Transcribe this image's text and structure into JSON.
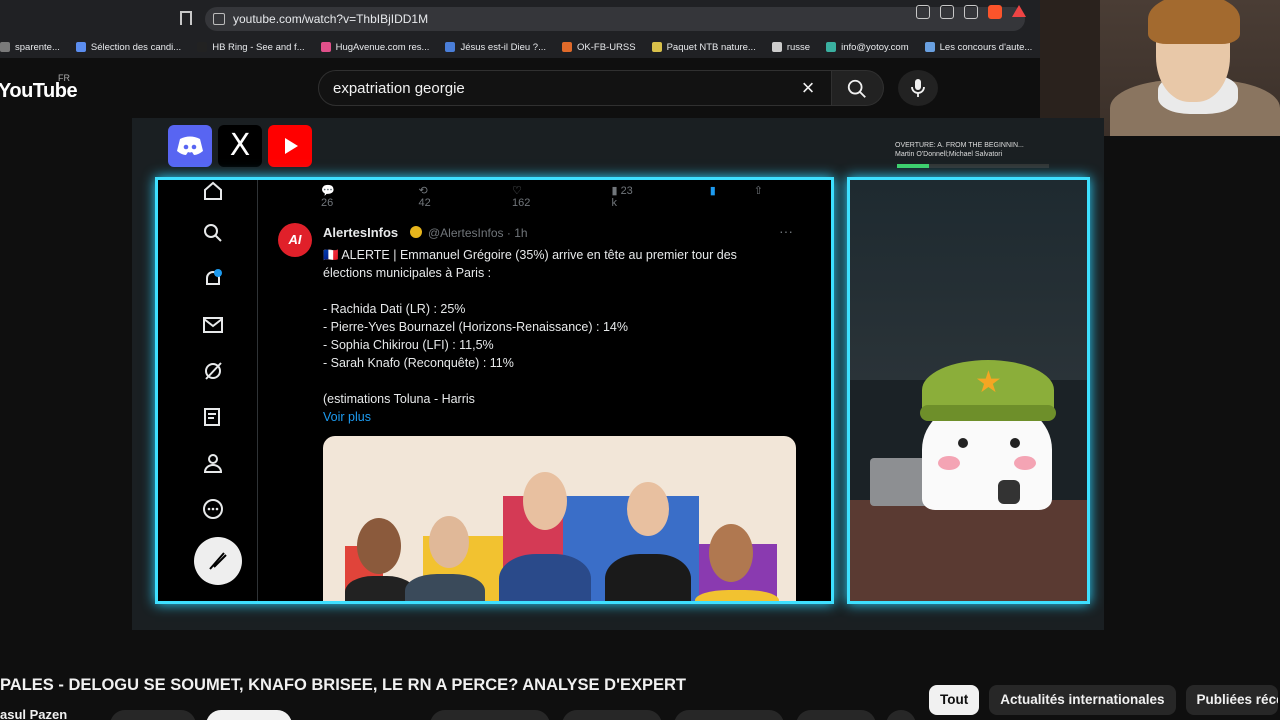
{
  "browser": {
    "url": "youtube.com/watch?v=ThbIBjIDD1M",
    "bookmarks": [
      {
        "label": "sparente...",
        "color": "#7a7a7a"
      },
      {
        "label": "Sélection des candi...",
        "color": "#5b8def"
      },
      {
        "label": "HB Ring - See and f...",
        "color": "#222222"
      },
      {
        "label": "HugAvenue.com res...",
        "color": "#e0508a"
      },
      {
        "label": "Jésus est-il Dieu ?...",
        "color": "#4a7ed8"
      },
      {
        "label": "OK-FB-URSS",
        "color": "#e06a2a"
      },
      {
        "label": "Paquet NTB nature...",
        "color": "#d8c04a"
      },
      {
        "label": "russe",
        "color": "#cccccc"
      },
      {
        "label": "info@yotoy.com",
        "color": "#3ab0a0"
      },
      {
        "label": "Les concours d'aute...",
        "color": "#6aa0e0"
      },
      {
        "label": "yotoy",
        "color": "#cccccc"
      }
    ]
  },
  "youtube": {
    "logo": "YouTube",
    "region": "FR",
    "search_value": "expatriation georgie",
    "clear_icon": "×"
  },
  "overlay": {
    "social": {
      "x_label": "X"
    },
    "now_playing_title": "OVERTURE: A. FROM THE BEGINNIN...",
    "now_playing_artist": "Martin O'Donnell;Michael Salvatori",
    "progress": 0.21
  },
  "tweet": {
    "stats": {
      "replies": "26",
      "reposts": "42",
      "likes": "162",
      "views": "23 k"
    },
    "avatar_text": "AI",
    "author": "AlertesInfos",
    "handle": "@AlertesInfos · 1h",
    "more": "···",
    "lines": [
      "🇫🇷 ALERTE | Emmanuel Grégoire (35%) arrive en tête au premier tour des",
      "élections municipales à Paris :",
      "",
      "- Rachida Dati (LR) : 25%",
      "- Pierre-Yves Bournazel (Horizons-Renaissance) : 14%",
      "- Sophia Chikirou (LFI) : 11,5%",
      "- Sarah Knafo (Reconquête) : 11%",
      "",
      "(estimations Toluna - Harris"
    ],
    "see_more": "Voir plus"
  },
  "video": {
    "title": "PALES - DELOGU SE SOUMET, KNAFO BRISEE, LE RN A PERCE? ANALYSE D'EXPERT",
    "channel": "asul Pazen"
  },
  "chips": [
    "Tout",
    "Actualités internationales",
    "Publiées réce"
  ]
}
